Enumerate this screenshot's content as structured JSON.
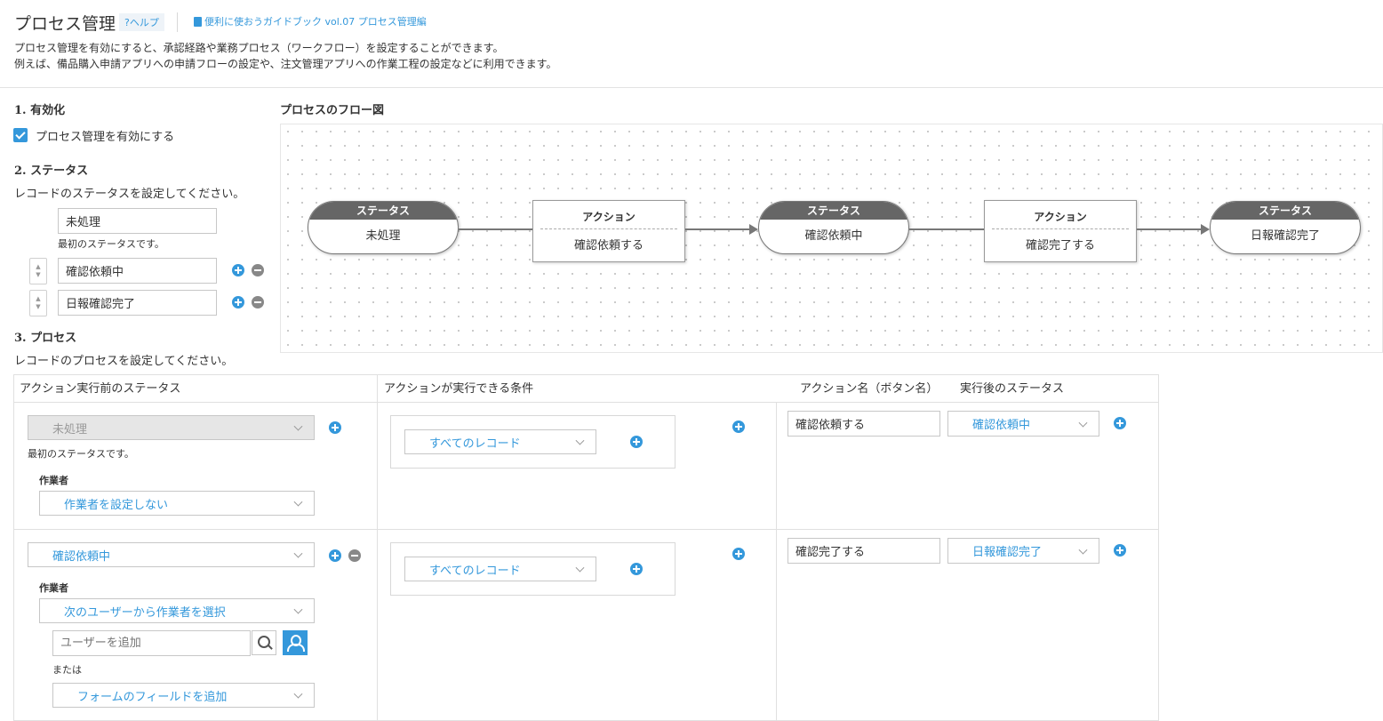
{
  "header": {
    "title": "プロセス管理",
    "help": "?ヘルプ",
    "guide": "便利に使おうガイドブック vol.07 プロセス管理編",
    "desc1": "プロセス管理を有効にすると、承認経路や業務プロセス（ワークフロー）を設定することができます。",
    "desc2": "例えば、備品購入申請アプリへの申請フローの設定や、注文管理アプリへの作業工程の設定などに利用できます。"
  },
  "enable": {
    "heading": "1. 有効化",
    "checkbox_label": "プロセス管理を有効にする",
    "checked": true
  },
  "statuses": {
    "heading": "2. ステータス",
    "desc": "レコードのステータスを設定してください。",
    "first_note": "最初のステータスです。",
    "items": [
      "未処理",
      "確認依頼中",
      "日報確認完了"
    ]
  },
  "process": {
    "heading": "3. プロセス",
    "desc": "レコードのプロセスを設定してください。"
  },
  "flow": {
    "title": "プロセスのフロー図",
    "status_header": "ステータス",
    "action_header": "アクション",
    "statuses": [
      "未処理",
      "確認依頼中",
      "日報確認完了"
    ],
    "actions": [
      "確認依頼する",
      "確認完了する"
    ]
  },
  "table": {
    "headers": {
      "before": "アクション実行前のステータス",
      "condition": "アクションが実行できる条件",
      "action_name": "アクション名（ボタン名）",
      "after": "実行後のステータス"
    },
    "worker_label": "作業者",
    "first_note": "最初のステータスです。",
    "rows": [
      {
        "status": "未処理",
        "worker": "作業者を設定しない",
        "condition": "すべてのレコード",
        "action": "確認依頼する",
        "next": "確認依頼中"
      },
      {
        "status": "確認依頼中",
        "worker": "次のユーザーから作業者を選択",
        "user_placeholder": "ユーザーを追加",
        "or": "または",
        "field": "フォームのフィールドを追加",
        "condition": "すべてのレコード",
        "action": "確認完了する",
        "next": "日報確認完了"
      }
    ]
  },
  "colors": {
    "accent": "#3498db",
    "node_header": "#666666",
    "text": "#333333"
  }
}
